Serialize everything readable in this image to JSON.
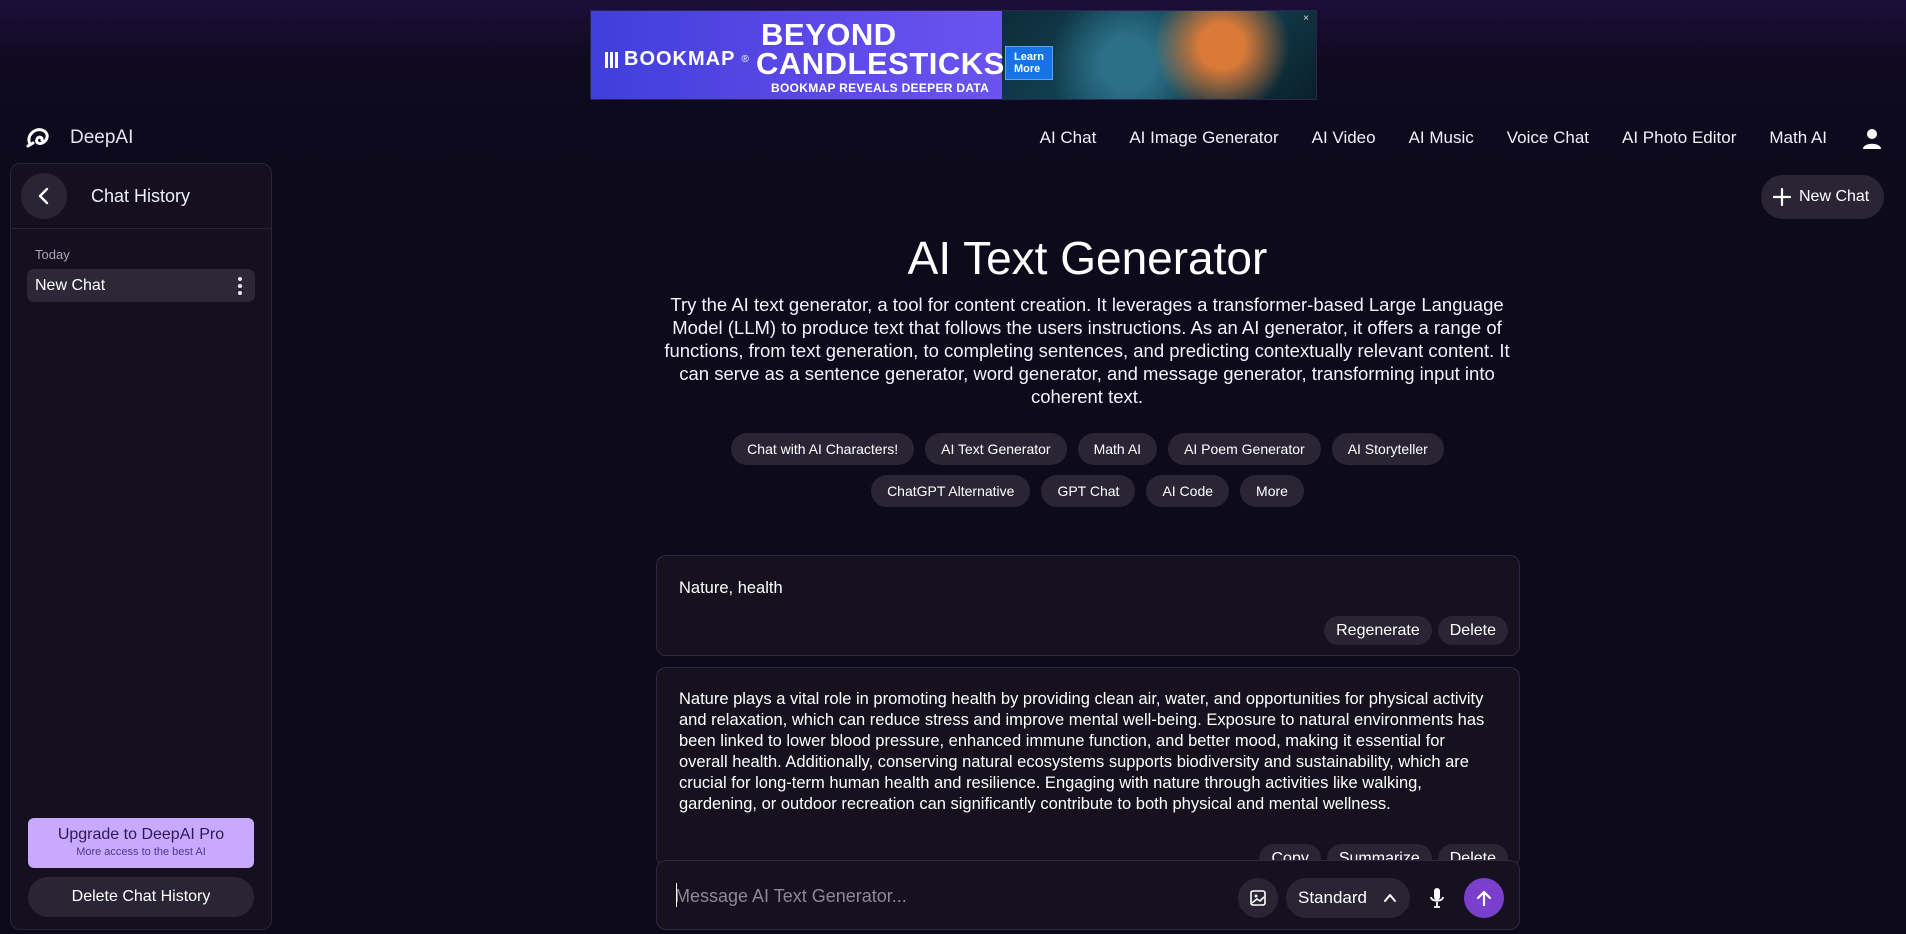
{
  "ad": {
    "brand": "BOOKMAP",
    "brand_mark": "®",
    "headline_1": "BEYOND",
    "headline_2": "CANDLESTICKS",
    "subline": "BOOKMAP REVEALS DEEPER DATA",
    "cta": "Learn More"
  },
  "brand": {
    "name": "DeepAI"
  },
  "nav": {
    "items": [
      "AI Chat",
      "AI Image Generator",
      "AI Video",
      "AI Music",
      "Voice Chat",
      "AI Photo Editor",
      "Math AI"
    ]
  },
  "sidebar": {
    "title": "Chat History",
    "group_label": "Today",
    "chats": [
      "New Chat"
    ],
    "upgrade_title": "Upgrade to DeepAI Pro",
    "upgrade_sub": "More access to the best AI",
    "delete_history": "Delete Chat History"
  },
  "new_chat_label": "New Chat",
  "main": {
    "title": "AI Text Generator",
    "description": "Try the AI text generator, a tool for content creation. It leverages a transformer-based Large Language Model (LLM) to produce text that follows the users instructions. As an AI generator, it offers a range of functions, from text generation, to completing sentences, and predicting contextually relevant content. It can serve as a sentence generator, word generator, and message generator, transforming input into coherent text.",
    "chips_row1": [
      "Chat with AI Characters!",
      "AI Text Generator",
      "Math AI",
      "AI Poem Generator",
      "AI Storyteller"
    ],
    "chips_row2": [
      "ChatGPT Alternative",
      "GPT Chat",
      "AI Code",
      "More"
    ]
  },
  "conversation": {
    "user_message": "Nature, health",
    "user_actions": [
      "Regenerate",
      "Delete"
    ],
    "ai_message": "Nature plays a vital role in promoting health by providing clean air, water, and opportunities for physical activity and relaxation, which can reduce stress and improve mental well-being. Exposure to natural environments has been linked to lower blood pressure, enhanced immune function, and better mood, making it essential for overall health. Additionally, conserving natural ecosystems supports biodiversity and sustainability, which are crucial for long-term human health and resilience. Engaging with nature through activities like walking, gardening, or outdoor recreation can significantly contribute to both physical and mental wellness.",
    "ai_actions": [
      "Copy",
      "Summarize",
      "Delete"
    ]
  },
  "composer": {
    "placeholder": "Message AI Text Generator...",
    "mode": "Standard"
  },
  "colors": {
    "background": "#0c0a1a",
    "panel": "#15111f",
    "pill": "#2a2535",
    "send_button": "#7b3fd0",
    "upgrade": "#c9a8ff"
  }
}
